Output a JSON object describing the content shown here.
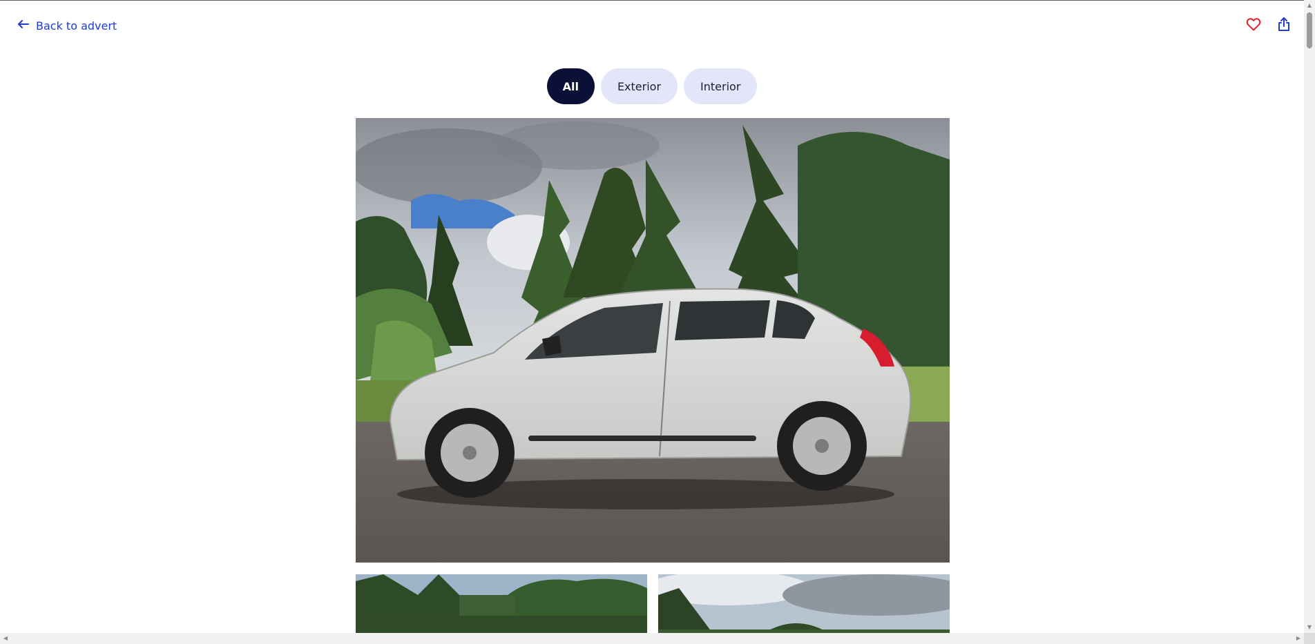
{
  "header": {
    "back_label": "Back to advert",
    "icons": {
      "back": "arrow-left-icon",
      "favourite": "heart-icon",
      "share": "share-icon"
    }
  },
  "tabs": [
    {
      "label": "All",
      "active": true
    },
    {
      "label": "Exterior",
      "active": false
    },
    {
      "label": "Interior",
      "active": false
    }
  ],
  "gallery": {
    "main_photo": "white-hatchback-side-view-photo",
    "thumbnails": [
      "trees-and-sky-photo",
      "cloudy-sky-photo"
    ]
  },
  "colors": {
    "link_blue": "#1f3bd6",
    "heart_red": "#e4202f",
    "tab_active_bg": "#0b1036",
    "tab_inactive_bg": "#e3e6f8"
  }
}
